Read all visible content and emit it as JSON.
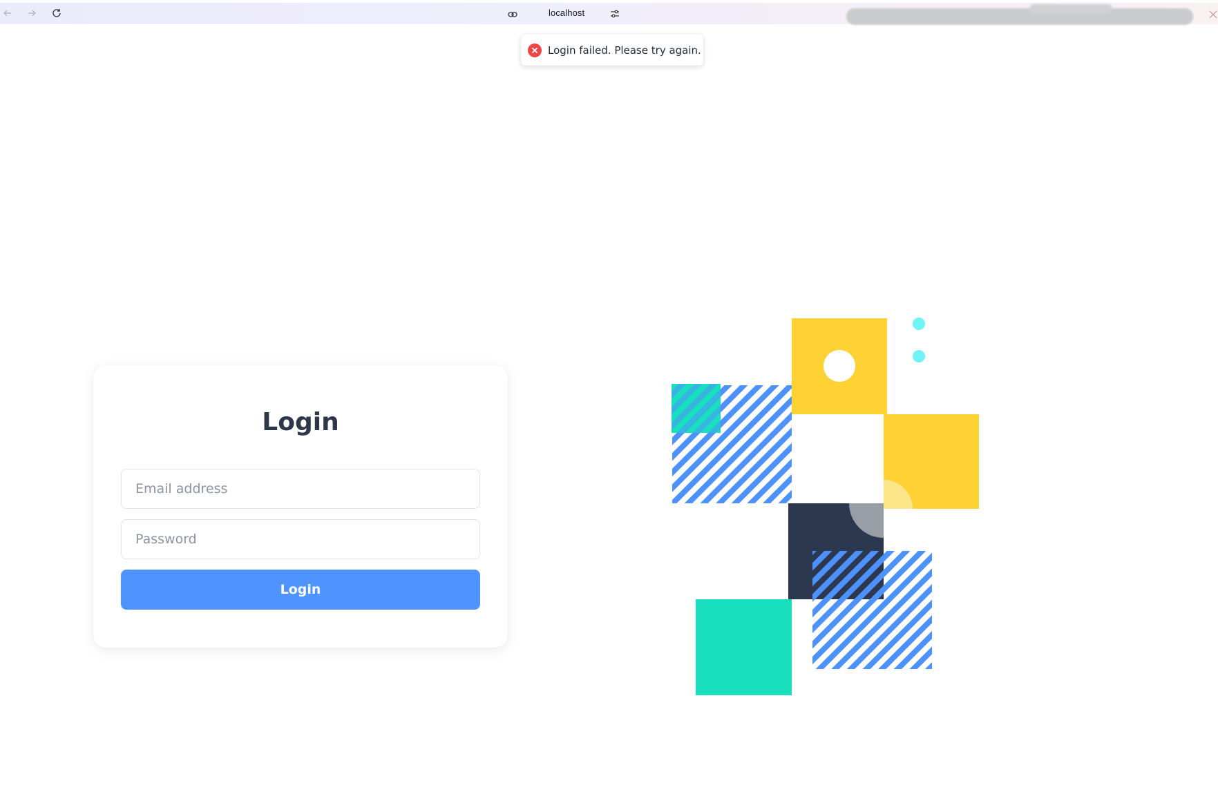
{
  "browser": {
    "url": "localhost"
  },
  "toast": {
    "message": "Login failed. Please try again.",
    "type": "error",
    "icon": "error-circle-icon",
    "color": "#ef4444"
  },
  "login": {
    "title": "Login",
    "email_placeholder": "Email address",
    "email_value": "",
    "password_placeholder": "Password",
    "password_value": "",
    "button_label": "Login",
    "button_color": "#4f94fe"
  },
  "illustration": {
    "colors": {
      "yellow": "#fed234",
      "light_yellow": "#fde68a",
      "navy": "#2c3750",
      "teal": "#18dfbd",
      "blue_stripe": "#4d92fc",
      "cyan_dot": "#6ff5f5",
      "gray": "#989ea6"
    }
  }
}
